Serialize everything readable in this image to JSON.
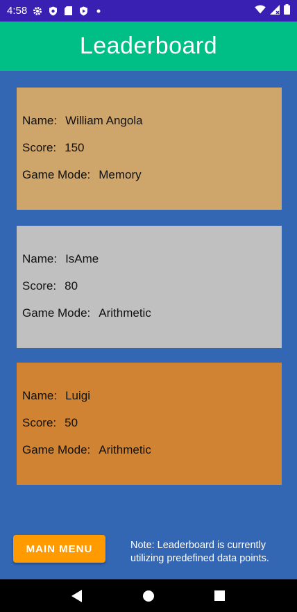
{
  "status_bar": {
    "time": "4:58",
    "left_icons": [
      "gear-icon",
      "shield-icon",
      "sd-card-icon",
      "shield-play-icon",
      "dot-icon"
    ],
    "right_icons": [
      "wifi-icon",
      "signal-icon",
      "battery-icon"
    ]
  },
  "app_bar": {
    "title": "Leaderboard"
  },
  "labels": {
    "name": "Name:",
    "score": "Score:",
    "game_mode": "Game Mode:"
  },
  "entries": [
    {
      "name": "William Angola",
      "score": "150",
      "game_mode": "Memory",
      "color": "#cea56a"
    },
    {
      "name": "IsAme",
      "score": "80",
      "game_mode": "Arithmetic",
      "color": "#c0c0c0"
    },
    {
      "name": "Luigi",
      "score": "50",
      "game_mode": "Arithmetic",
      "color": "#d08433"
    }
  ],
  "footer": {
    "main_menu_label": "MAIN MENU",
    "note": "Note: Leaderboard is currently utilizing predefined data points."
  },
  "colors": {
    "status_bar": "#3a1fb3",
    "app_bar": "#00bf86",
    "background": "#3366b3",
    "button": "#ff9a00"
  },
  "nav_bar": {
    "icons": [
      "back-icon",
      "home-icon",
      "recents-icon"
    ]
  }
}
